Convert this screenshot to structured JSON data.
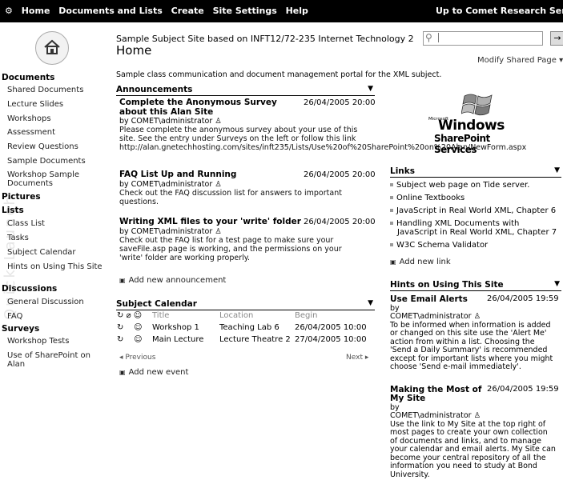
{
  "topnav": {
    "items": [
      "Home",
      "Documents and Lists",
      "Create",
      "Site Settings",
      "Help"
    ],
    "up_to": "Up to Comet Research Server"
  },
  "header": {
    "site_name": "Sample Subject Site based on INFT12/72-235 Internet Technology 2",
    "page_title": "Home",
    "search_value": "",
    "go_label": "→",
    "modify_label": "Modify Shared Page ▾"
  },
  "quicklaunch": {
    "watermark": "Quick Launch",
    "sections": [
      {
        "head": "Documents",
        "items": [
          "Shared Documents",
          "Lecture Slides",
          "Workshops",
          "Assessment",
          "Review Questions",
          "Sample Documents",
          "Workshop Sample Documents"
        ]
      },
      {
        "head": "Pictures",
        "items": []
      },
      {
        "head": "Lists",
        "items": [
          "Class List",
          "Tasks",
          "Subject Calendar",
          "Hints on Using This Site"
        ]
      },
      {
        "head": "Discussions",
        "items": [
          "General Discussion",
          "FAQ"
        ]
      },
      {
        "head": "Surveys",
        "items": [
          "Workshop Tests",
          "Use of SharePoint on Alan"
        ]
      }
    ]
  },
  "description": "Sample class communication and document management portal for the XML subject.",
  "announcements": {
    "title": "Announcements",
    "items": [
      {
        "title": "Complete the Anonymous Survey about this Alan Site",
        "date": "26/04/2005 20:00",
        "by": "by COMET\\administrator",
        "body": "Please complete the anonymous survey about your use of this site. See the entry under Surveys on the left or follow this link http://alan.gnetechhosting.com/sites/inft235/Lists/Use%20of%20SharePoint%20on%20Alan/NewForm.aspx"
      },
      {
        "title": "FAQ List Up and Running",
        "date": "26/04/2005 20:00",
        "by": "by COMET\\administrator",
        "body": "Check out the  FAQ discussion list for answers to important questions."
      },
      {
        "title": "Writing XML files to your 'write' folder",
        "date": "26/04/2005 20:00",
        "by": "by COMET\\administrator",
        "body": "Check out the FAQ list for a test page to make sure your saveFile.asp page is working, and the permissions on your 'write' folder are working properly."
      }
    ],
    "add_label": "Add new announcement"
  },
  "calendar": {
    "title": "Subject Calendar",
    "columns": [
      "Title",
      "Location",
      "Begin"
    ],
    "rows": [
      {
        "title": "Workshop 1",
        "location": "Teaching Lab 6",
        "begin": "26/04/2005 10:00"
      },
      {
        "title": "Main Lecture",
        "location": "Lecture Theatre 2",
        "begin": "27/04/2005 10:00"
      }
    ],
    "prev_label": "◂ Previous",
    "next_label": "Next ▸",
    "add_label": "Add new event"
  },
  "logo": {
    "microsoft": "Microsoft",
    "windows": "Windows",
    "sharepoint": "SharePoint Services"
  },
  "links": {
    "title": "Links",
    "items": [
      "Subject web page on Tide server.",
      "Online Textbooks",
      "JavaScript in Real World XML, Chapter 6",
      "Handling XML Documents with JavaScript in Real World XML, Chapter 7",
      "W3C Schema Validator"
    ],
    "add_label": "Add new link"
  },
  "hints": {
    "title": "Hints on Using This Site",
    "items": [
      {
        "title": "Use Email Alerts",
        "date": "26/04/2005 19:59",
        "by1": "by",
        "by2": "COMET\\administrator",
        "body": "To be informed when information is added or changed on this site use the 'Alert Me' action from within a list. Choosing the 'Send a Daily Summary' is recommended except for important lists where you might choose 'Send e-mail immediately'."
      },
      {
        "title": "Making the Most of My Site",
        "date": "26/04/2005 19:59",
        "by1": "by",
        "by2": "COMET\\administrator",
        "body": "Use the link to My Site at the top right of most pages to create your own collection of documents and links, and to manage your calendar and email alerts. My Site can become your central repository of all the information you need to study at Bond University."
      }
    ]
  }
}
